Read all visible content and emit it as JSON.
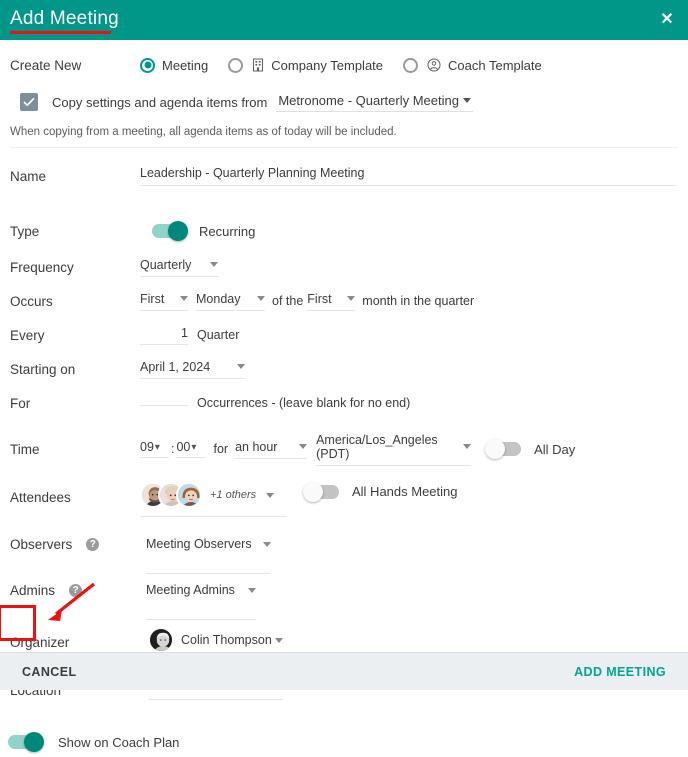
{
  "header": {
    "title": "Add Meeting",
    "close_icon": "close-icon"
  },
  "create_new": {
    "label": "Create New",
    "options": [
      {
        "label": "Meeting",
        "selected": true,
        "icon": ""
      },
      {
        "label": "Company Template",
        "selected": false,
        "icon": "building-icon"
      },
      {
        "label": "Coach Template",
        "selected": false,
        "icon": "person-circle-icon"
      }
    ]
  },
  "copy_settings": {
    "checked": true,
    "text": "Copy settings and agenda items from",
    "source": "Metronome - Quarterly Meeting",
    "note": "When copying from a meeting, all agenda items as of today will be included."
  },
  "name": {
    "label": "Name",
    "value": "Leadership - Quarterly Planning Meeting"
  },
  "type": {
    "label": "Type",
    "toggle_label": "Recurring",
    "toggle_on": true
  },
  "frequency": {
    "label": "Frequency",
    "value": "Quarterly"
  },
  "occurs": {
    "label": "Occurs",
    "ordinal": "First",
    "weekday": "Monday",
    "connector": "of the",
    "month_ordinal": "First",
    "suffix": "month in the quarter"
  },
  "every": {
    "label": "Every",
    "value": "1",
    "unit": "Quarter"
  },
  "starting_on": {
    "label": "Starting on",
    "value": "April 1, 2024"
  },
  "for": {
    "label": "For",
    "value": "",
    "hint": "Occurrences - (leave blank for no end)"
  },
  "time": {
    "label": "Time",
    "hour": "09",
    "separator": ":",
    "minute": "00",
    "for_text": "for",
    "duration": "an hour",
    "timezone": "America/Los_Angeles (PDT)",
    "all_day_label": "All Day",
    "all_day_on": false
  },
  "attendees": {
    "label": "Attendees",
    "others": "+1 others",
    "all_hands_label": "All Hands Meeting",
    "all_hands_on": false,
    "avatars": [
      "attendee-avatar-1",
      "attendee-avatar-2",
      "attendee-avatar-3"
    ]
  },
  "observers": {
    "label": "Observers",
    "help_icon": "help-icon",
    "value": "Meeting Observers"
  },
  "admins": {
    "label": "Admins",
    "help_icon": "help-icon",
    "value": "Meeting Admins"
  },
  "organizer": {
    "label": "Organizer",
    "value": "Colin Thompson"
  },
  "location": {
    "label": "Location",
    "value": ""
  },
  "coach_plan": {
    "toggle_on": true,
    "label": "Show on Coach Plan"
  },
  "footer": {
    "cancel": "CANCEL",
    "submit": "ADD MEETING"
  },
  "colors": {
    "header_bg": "#009688",
    "accent": "#00a58f",
    "annotation": "#ee1111",
    "toggle_on_track": "#8fd3cb",
    "toggle_on_knob": "#00897b",
    "footer_bg": "#eceff1"
  }
}
